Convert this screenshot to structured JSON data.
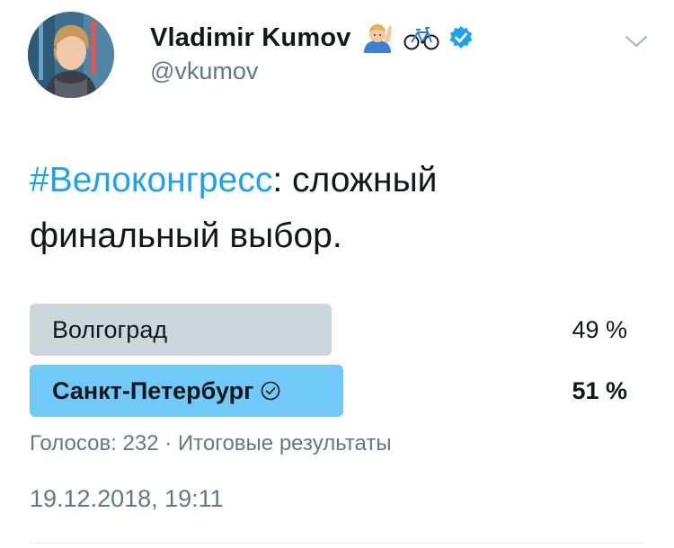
{
  "author": {
    "display_name": "Vladimir Kumov",
    "handle": "@vkumov",
    "name_emojis": [
      "raising-hand-icon",
      "bicycle-icon"
    ],
    "verified": true
  },
  "tweet": {
    "hashtag": "#Велоконгресс",
    "text_line1_rest": ": сложный",
    "text_line2": "финальный выбор."
  },
  "poll": {
    "options": [
      {
        "label": "Волгоград",
        "percent_text": "49 %",
        "percent": 49,
        "winner": false
      },
      {
        "label": "Санкт-Петербург",
        "percent_text": "51 %",
        "percent": 51,
        "winner": true
      }
    ],
    "votes_text": "Голосов: 232",
    "separator": " · ",
    "status_text": "Итоговые результаты"
  },
  "timestamp": "19.12.2018, 19:11",
  "colors": {
    "link": "#1da1f2",
    "winner_bar": "#71c9f8",
    "loser_bar": "#ccd6dd",
    "secondary_text": "#657786",
    "verified_badge": "#1da1f2"
  }
}
